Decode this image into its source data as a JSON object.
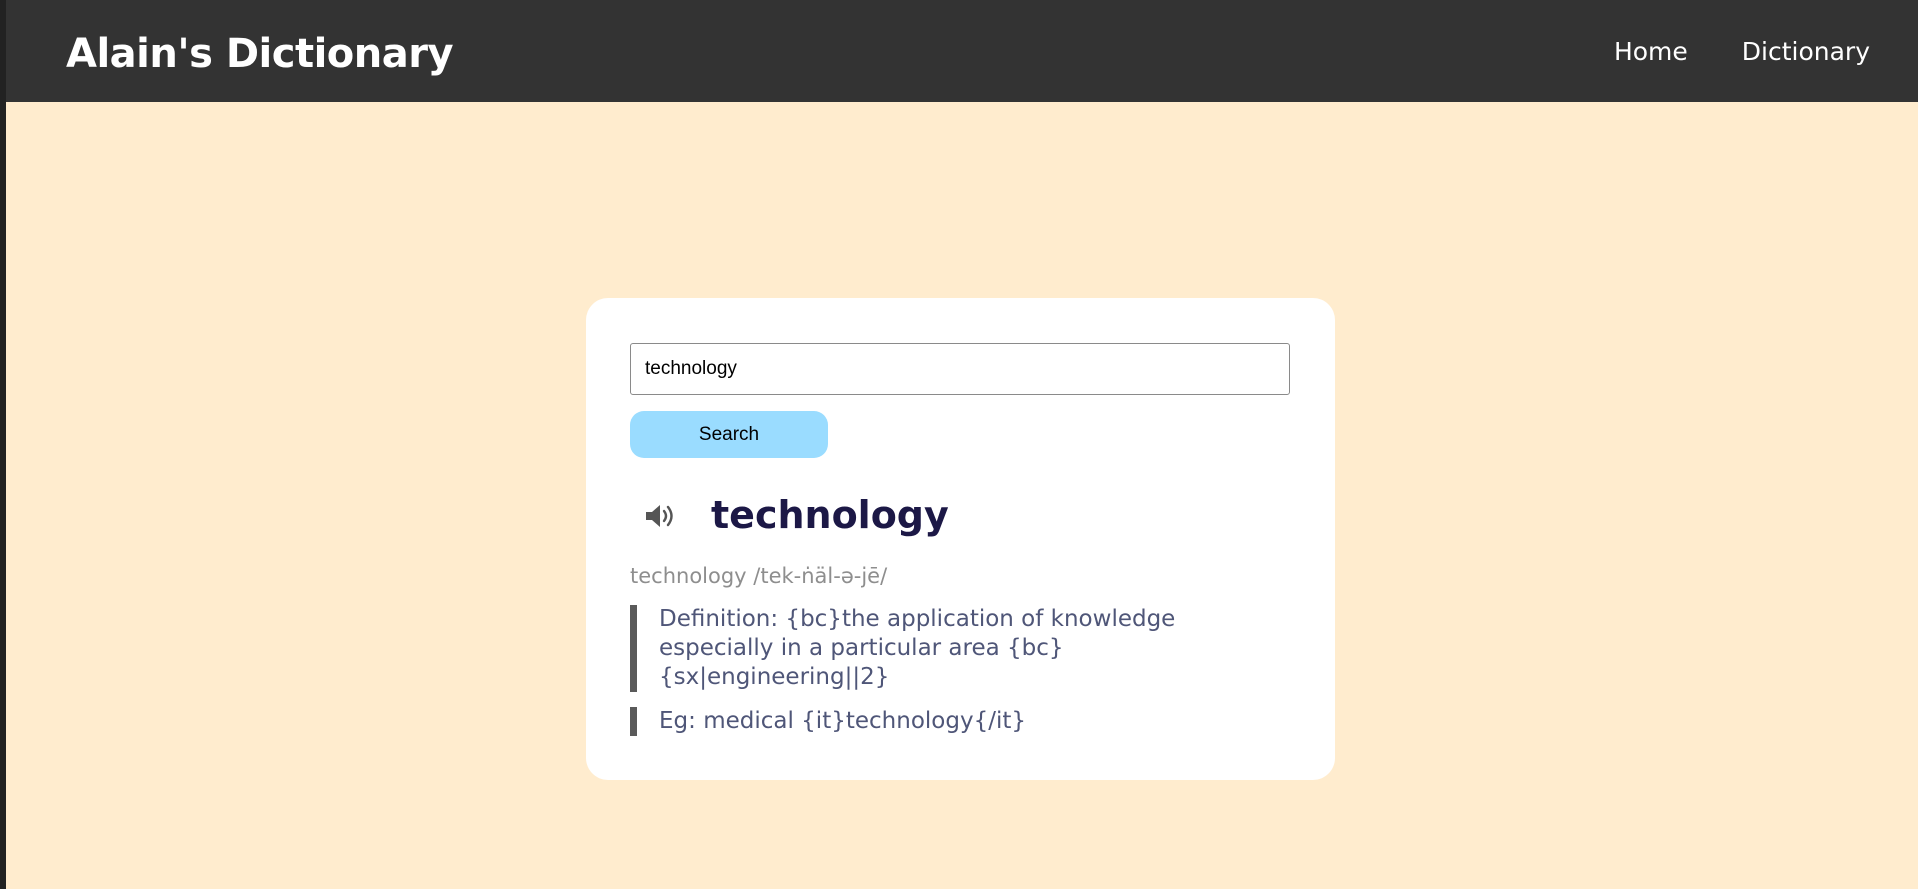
{
  "navbar": {
    "brand": "Alain's Dictionary",
    "links": [
      "Home",
      "Dictionary"
    ]
  },
  "search": {
    "value": "technology",
    "button_label": "Search"
  },
  "entry": {
    "word": "technology",
    "phonetic": "technology /tek-ṅäl-ə-jē/",
    "definition": "Definition: {bc}the application of knowledge especially in a particular area {bc}{sx|engineering||2}",
    "example": "Eg: medical {it}technology{/it}"
  },
  "colors": {
    "navbar_bg": "#333333",
    "page_bg": "#ffecce",
    "button_bg": "#9adcff",
    "word_color": "#1c1846"
  },
  "icons": {
    "audio": "speaker-icon"
  }
}
